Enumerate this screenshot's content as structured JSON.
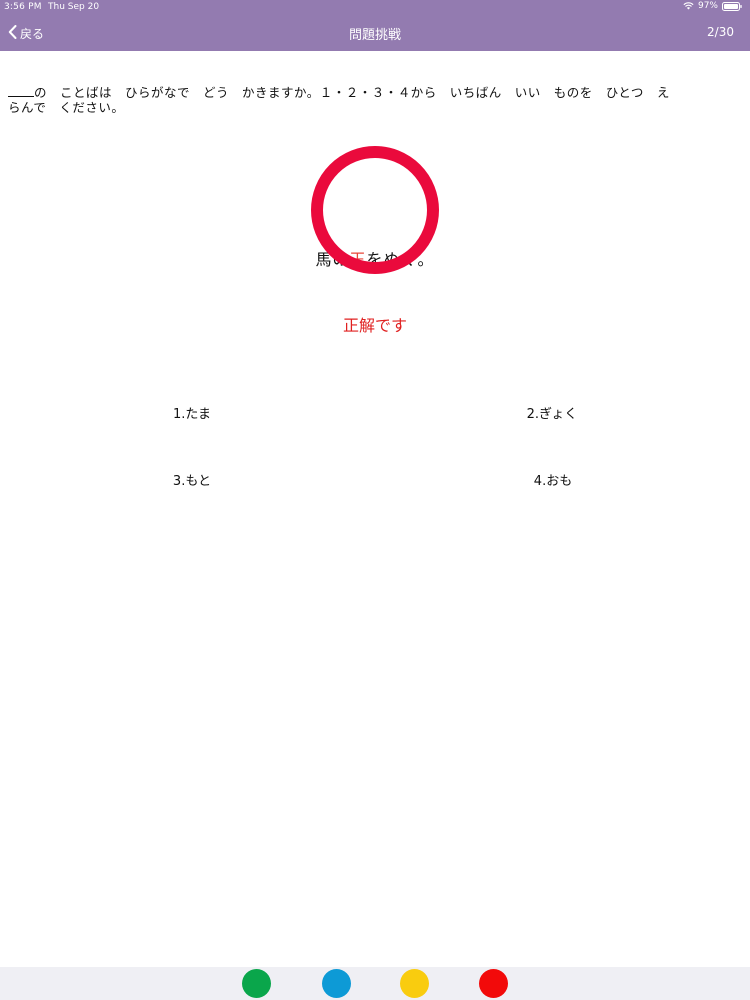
{
  "status_bar": {
    "time": "3:56 PM",
    "date": "Thu Sep 20",
    "battery": "97%"
  },
  "nav": {
    "back_label": "戻る",
    "title": "問題挑戦",
    "counter": "2/30"
  },
  "question": {
    "line1_text": "の　ことばは　ひらがなで　どう　かきますか。１・２・３・４から　いちばん　いい　ものを　ひとつ　え",
    "line2_text": "らんで　ください。"
  },
  "sentence": {
    "before": "馬の",
    "highlight": "玉",
    "after": "をぬく。"
  },
  "result_text": "正解です",
  "options": [
    {
      "label": "1.たま"
    },
    {
      "label": "2.ぎょく"
    },
    {
      "label": "3.もと"
    },
    {
      "label": "4.おも"
    }
  ],
  "colors": {
    "header": "#937bb0",
    "circle": "#ea0a3c",
    "result": "#e02020",
    "dots": [
      "#0aa64b",
      "#0d9ad6",
      "#f9cc0f",
      "#f20a0a"
    ]
  },
  "bottom_dots": [
    "green-dot",
    "blue-dot",
    "yellow-dot",
    "red-dot"
  ]
}
